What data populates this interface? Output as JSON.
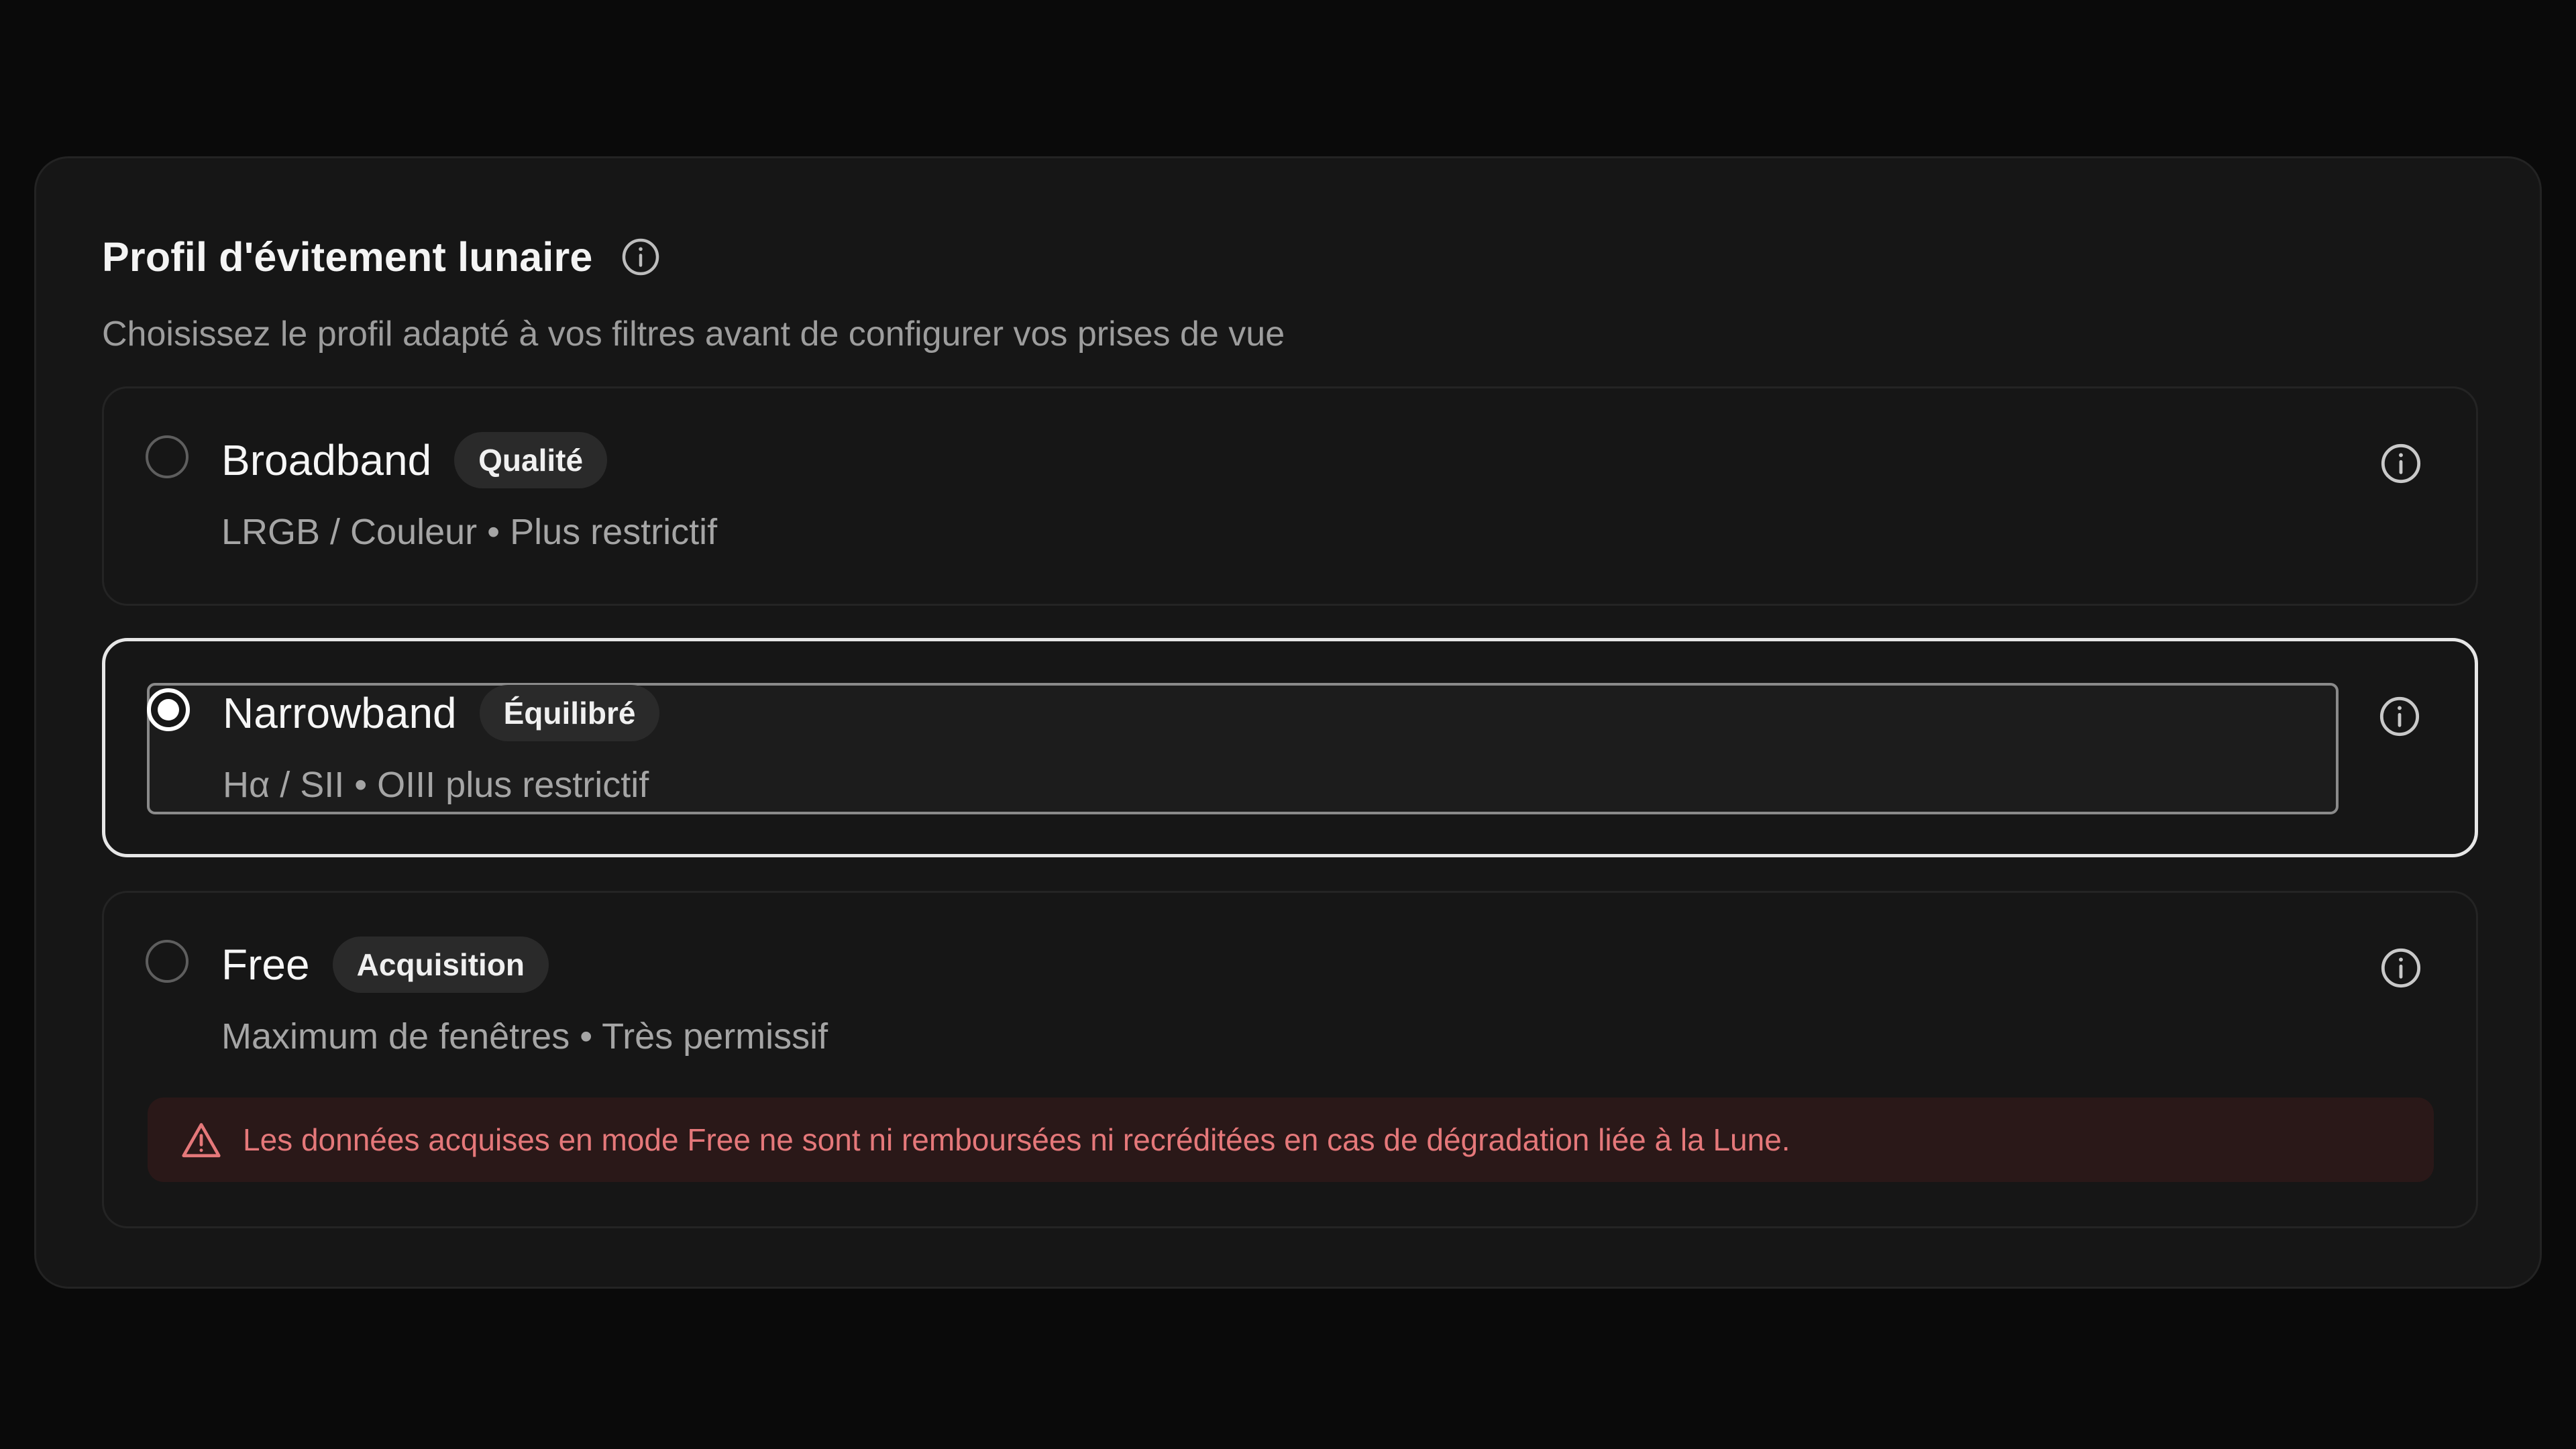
{
  "panel": {
    "title": "Profil d'évitement lunaire",
    "subtitle": "Choisissez le profil adapté à vos filtres avant de configurer vos prises de vue"
  },
  "options": [
    {
      "name": "Broadband",
      "tag": "Qualité",
      "description": "LRGB / Couleur • Plus restrictif",
      "selected": false
    },
    {
      "name": "Narrowband",
      "tag": "Équilibré",
      "description": "Hα / SII • OIII plus restrictif",
      "selected": true
    },
    {
      "name": "Free",
      "tag": "Acquisition",
      "description": "Maximum de fenêtres • Très permissif",
      "selected": false,
      "warning": "Les données acquises en mode Free ne sont ni remboursées ni recréditées en cas de dégradation liée à la Lune."
    }
  ],
  "icons": {
    "info": "info-circle-icon",
    "warning": "warning-triangle-icon"
  },
  "colors": {
    "background": "#0a0a0a",
    "panel": "#161616",
    "selected_border": "#e6e6e6",
    "warning_text": "#e5787a",
    "warning_bg": "#2a1818"
  }
}
